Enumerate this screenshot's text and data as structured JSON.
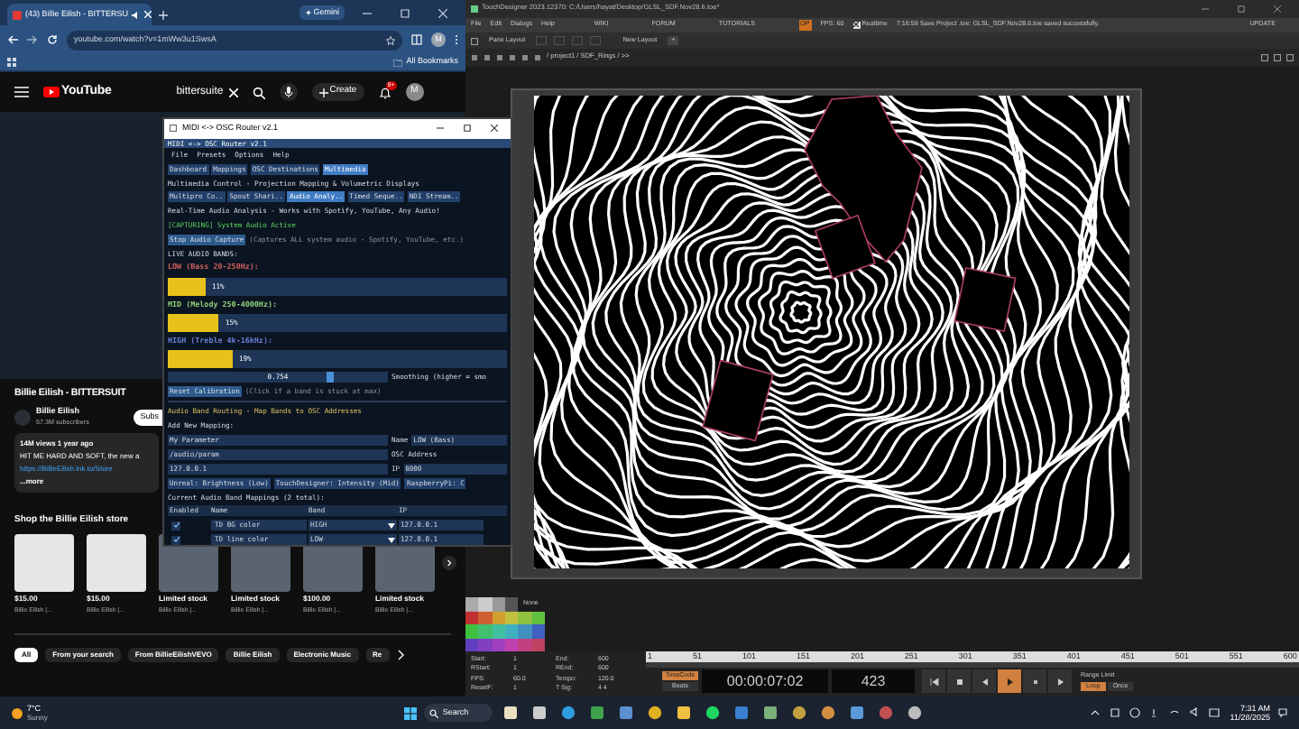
{
  "browser": {
    "tab": {
      "title": "(43) Billie Eilish - BITTERSU"
    },
    "gemini": "Gemini",
    "url": "youtube.com/watch?v=1mWw3u1SwsA",
    "profile": "M",
    "bookmarks": "All Bookmarks"
  },
  "youtube": {
    "logo": "YouTube",
    "search": {
      "value": "bittersuite"
    },
    "create": "Create",
    "notification_count": "9+",
    "avatar": "M",
    "video_title": "Billie Eilish - BITTERSUIT",
    "channel": "Billie Eilish",
    "subscribers": "57.3M subscribers",
    "subscribe": "Subs",
    "description": {
      "meta": "14M views  1 year ago",
      "text": "HIT ME HARD AND SOFT, the new a",
      "link": "https://BillieEilish.lnk.to/Store",
      "more": "...more"
    },
    "store_title": "Shop the Billie Eilish store",
    "products": [
      {
        "price": "$15.00",
        "seller": "Billie Eilish |..."
      },
      {
        "price": "$15.00",
        "seller": "Billie Eilish |..."
      },
      {
        "price": "Limited stock",
        "seller": "Billie Eilish |..."
      },
      {
        "price": "Limited stock",
        "seller": "Billie Eilish |..."
      },
      {
        "price": "$100.00",
        "seller": "Billie Eilish |..."
      },
      {
        "price": "Limited stock",
        "seller": "Billie Eilish |..."
      }
    ],
    "chips": [
      {
        "label": "All",
        "selected": true
      },
      {
        "label": "From your search",
        "selected": false
      },
      {
        "label": "From BillieEilishVEVO",
        "selected": false
      },
      {
        "label": "Billie Eilish",
        "selected": false
      },
      {
        "label": "Electronic Music",
        "selected": false
      },
      {
        "label": "Re",
        "selected": false
      }
    ]
  },
  "router": {
    "window_title": "MIDI <-> OSC Router v2.1",
    "inner_title": "MIDI <-> OSC Router v2.1",
    "menu": [
      "File",
      "Presets",
      "Options",
      "Help"
    ],
    "tabs": [
      {
        "label": "Dashboard",
        "selected": false
      },
      {
        "label": "Mappings",
        "selected": false
      },
      {
        "label": "OSC Destinations",
        "selected": false
      },
      {
        "label": "Multimedia",
        "selected": true
      }
    ],
    "heading": "Multimedia Control - Projection Mapping & Volumetric Displays",
    "subtabs": [
      {
        "label": "Multipro Co..",
        "selected": false
      },
      {
        "label": "Spout Shari..",
        "selected": false
      },
      {
        "label": "Audio Analy..",
        "selected": true
      },
      {
        "label": "Timed Seque..",
        "selected": false
      },
      {
        "label": "NDI Stream..",
        "selected": false
      }
    ],
    "subheading": "Real-Time Audio Analysis - Works with Spotify, YouTube, Any Audio!",
    "status": "[CAPTURING] System Audio Active",
    "stop_button": "Stop Audio Capture",
    "capture_note": "(Captures ALL system audio - Spotify, YouTube, etc.)",
    "bands_title": "LIVE AUDIO BANDS:",
    "bands": [
      {
        "label": "LOW (Bass 20-250Hz):",
        "color": "#d0605a",
        "level": 0.11,
        "reading": "11%"
      },
      {
        "label": "MID (Melody 250-4000Hz):",
        "color": "#8fd07a",
        "level": 0.15,
        "reading": "15%"
      },
      {
        "label": "HIGH (Treble 4k-16kHz):",
        "color": "#6a80d8",
        "level": 0.19,
        "reading": "19%"
      }
    ],
    "smoothing": {
      "value": "0.754",
      "level": 0.754,
      "label": "Smoothing (higher = smo"
    },
    "reset_button": "Reset Calibration",
    "reset_note": "(Click if a band is stuck at max)",
    "routing_title": "Audio Band Routing - Map Bands to OSC Addresses",
    "add_title": "Add New Mapping:",
    "name_field": {
      "value": "My Parameter",
      "label": "Name"
    },
    "band_select": "LOW (Bass)",
    "address_field": {
      "value": "/audio/param",
      "label": "OSC Address"
    },
    "ip_field": {
      "value": "127.0.0.1",
      "label": "IP"
    },
    "port_field": "8000",
    "presets": [
      "Unreal: Brightness (Low)",
      "TouchDesigner: Intensity (Mid)",
      "RaspberryPi: C"
    ],
    "mappings_title": "Current Audio Band Mappings (2 total):",
    "columns": [
      "Enabled",
      "Name",
      "Band",
      "IP"
    ],
    "rows": [
      {
        "enabled": true,
        "name": "TD BG color",
        "band": "HIGH",
        "ip": "127.0.0.1"
      },
      {
        "enabled": true,
        "name": "TD line color",
        "band": "LOW",
        "ip": "127.0.0.1"
      }
    ]
  },
  "touchdesigner": {
    "title": "TouchDesigner 2023.12370: C:/Users/hayat/Desktop/GLSL_SDF.Nov28.6.toe*",
    "menu": [
      "File",
      "Edit",
      "Dialogs",
      "Help"
    ],
    "links": [
      "WIKI",
      "FORUM",
      "TUTORIALS"
    ],
    "op_badge": "OP",
    "fps": "FPS:  60",
    "realtime": {
      "label": "Realtime",
      "checked": true
    },
    "message": "7:16:59 Save Project .toe: GLSL_SDF.Nov28.6.toe saved successfully.",
    "update": "UPDATE",
    "pane_layout": "Pane Layout",
    "new_layout": "New Layout",
    "add_layout": "+",
    "path": "/ project1 / SDF_Rings / >>",
    "palette_label": "None",
    "info": [
      [
        "Start:",
        "1",
        "End:",
        "600"
      ],
      [
        "RStart:",
        "1",
        "REnd:",
        "600"
      ],
      [
        "FPS:",
        "60.0",
        "Tempo:",
        "120.0"
      ],
      [
        "ResetF:",
        "1",
        "T Sig:",
        "4    4"
      ]
    ],
    "ruler": [
      "1",
      "51",
      "101",
      "151",
      "201",
      "251",
      "301",
      "351",
      "401",
      "451",
      "501",
      "551",
      "600"
    ],
    "time_modes": [
      {
        "label": "TimeCode",
        "selected": true
      },
      {
        "label": "Beats",
        "selected": false
      }
    ],
    "timecode": "00:00:07:02",
    "frame": "423",
    "transport": [
      {
        "kind": "start",
        "selected": false
      },
      {
        "kind": "stop",
        "selected": false
      },
      {
        "kind": "back",
        "selected": false
      },
      {
        "kind": "play",
        "selected": true
      },
      {
        "kind": "step",
        "selected": false
      },
      {
        "kind": "forward",
        "selected": false
      }
    ],
    "range_title": "Range Limit",
    "range": [
      {
        "label": "Loop",
        "selected": true
      },
      {
        "label": "Once",
        "selected": false
      }
    ]
  },
  "taskbar": {
    "weather": {
      "temp": "7°C",
      "condition": "Sunny"
    },
    "search": "Search",
    "time": "7:31 AM",
    "date": "11/28/2025"
  }
}
